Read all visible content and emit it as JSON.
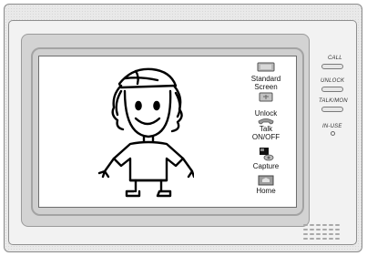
{
  "device": {
    "buttons": [
      {
        "id": "call",
        "label": "CALL"
      },
      {
        "id": "unlock",
        "label": "UNLOCK"
      },
      {
        "id": "talk_mon",
        "label": "TALK/MON"
      }
    ],
    "indicator_label": "IN-USE"
  },
  "screen": {
    "softkeys": {
      "standard_screen": {
        "line1": "Standard",
        "line2": "Screen",
        "icon": "monitor-icon"
      },
      "unlock": {
        "label": "Unlock",
        "icon": "unlock-icon"
      },
      "talk_onoff": {
        "line1": "Talk",
        "line2": "ON/OFF",
        "icon": "handset-icon"
      },
      "capture": {
        "label": "Capture",
        "icon": "camera-icon"
      },
      "home": {
        "label": "Home",
        "icon": "home-icon"
      }
    },
    "visitor_image": "cartoon-child-with-cap"
  },
  "colors": {
    "housing": "#e9e9e9",
    "screen": "#ffffff",
    "outline": "#000000"
  }
}
